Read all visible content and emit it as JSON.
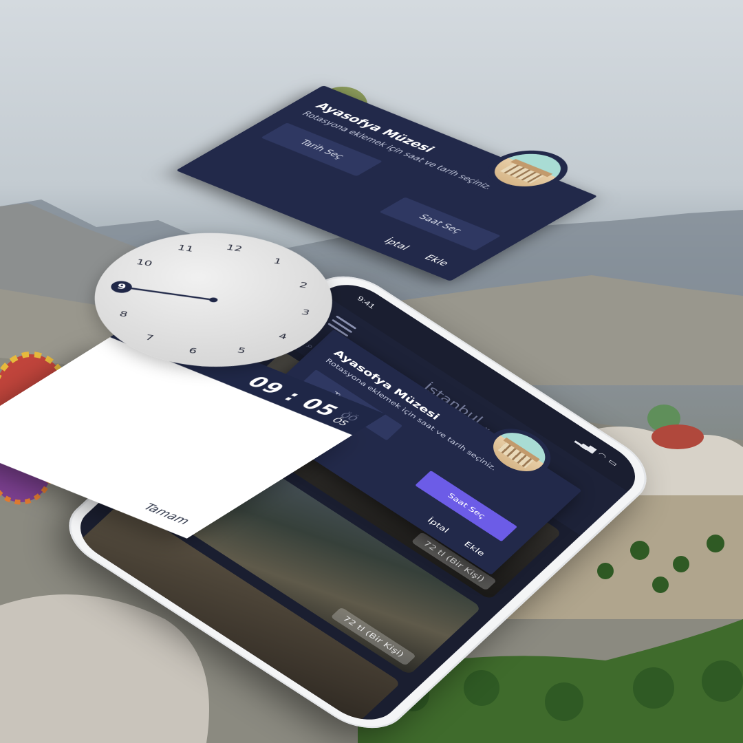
{
  "status_bar": {
    "time": "9:41"
  },
  "app": {
    "city": "İstanbul",
    "city_chevron": "⌄",
    "search_icon": "search-icon"
  },
  "place_cards": [
    {
      "price": "72 tl (Bir Kişi)"
    },
    {
      "price": "72 tl (Bir Kişi)"
    }
  ],
  "dialog": {
    "title": "Ayasofya Müzesi",
    "subtitle": "Rotasyona eklemek için saat ve tarih seçiniz.",
    "date_button": "Tarih Seç",
    "time_button": "Saat Seç",
    "cancel": "İptal",
    "add": "Ekle"
  },
  "time_picker": {
    "time": "09 : 05",
    "period_active": "ÖS",
    "period_inactive": "ÖÖ",
    "ok": "Tamam",
    "clock_numbers": [
      "12",
      "1",
      "2",
      "3",
      "4",
      "5",
      "6",
      "7",
      "8",
      "9",
      "10",
      "11"
    ],
    "selected_hour": "9"
  },
  "colors": {
    "navy": "#22294a",
    "accent": "#6c5ce7",
    "phone_body": "#f4f5f6"
  }
}
